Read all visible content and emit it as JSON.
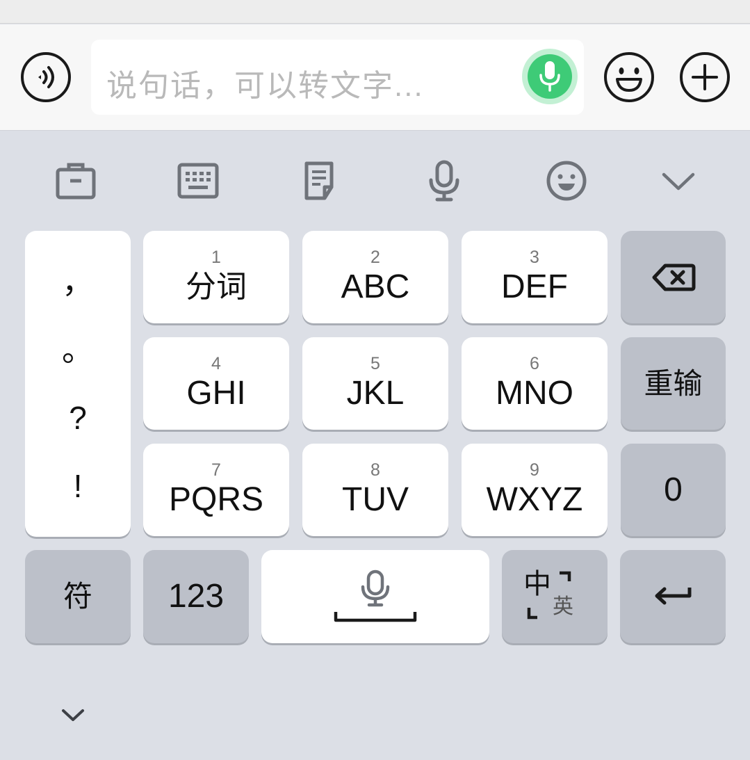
{
  "input_bar": {
    "placeholder": "说句话，可以转文字..."
  },
  "icons": {
    "voice_toggle": "voice-wave-icon",
    "mic": "microphone-icon",
    "emoji": "smiley-icon",
    "plus": "plus-icon",
    "toolbar": [
      "toolbox-icon",
      "keyboard-icon",
      "clipboard-icon",
      "microphone-icon",
      "smiley-icon",
      "chevron-down-icon"
    ],
    "backspace": "backspace-icon",
    "enter": "enter-icon",
    "collapse": "chevron-down-icon"
  },
  "keyboard": {
    "punctuation": [
      "，",
      "。",
      "?",
      "!"
    ],
    "keys": [
      {
        "num": "1",
        "label": "分词"
      },
      {
        "num": "2",
        "label": "ABC"
      },
      {
        "num": "3",
        "label": "DEF"
      },
      {
        "num": "4",
        "label": "GHI"
      },
      {
        "num": "5",
        "label": "JKL"
      },
      {
        "num": "6",
        "label": "MNO"
      },
      {
        "num": "7",
        "label": "PQRS"
      },
      {
        "num": "8",
        "label": "TUV"
      },
      {
        "num": "9",
        "label": "WXYZ"
      }
    ],
    "retype": "重输",
    "zero": "0",
    "symbols": "符",
    "numbers": "123",
    "lang_main": "中",
    "lang_sub": "英"
  },
  "colors": {
    "accent_green": "#3ecb77",
    "keyboard_bg": "#dcdfe6",
    "function_key": "#bcc0c9"
  }
}
